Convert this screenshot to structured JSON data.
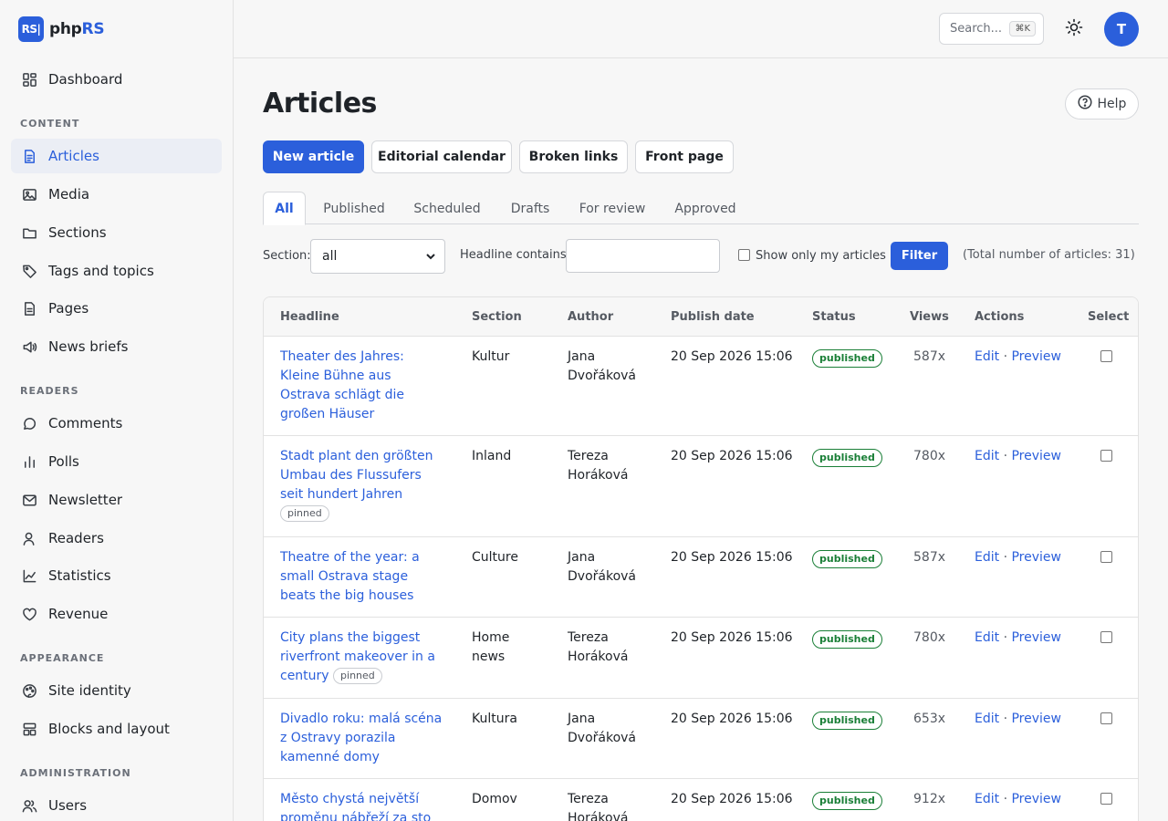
{
  "brand": {
    "logo_text": "RS|",
    "name_prefix": "php",
    "name_suffix": "RS",
    "accent": "#2b5fdb"
  },
  "sidebar": {
    "items": [
      {
        "label": "Dashboard",
        "icon": "dashboard-icon"
      },
      {
        "label": "Articles",
        "icon": "document-icon",
        "active": true
      },
      {
        "label": "Media",
        "icon": "image-icon"
      },
      {
        "label": "Sections",
        "icon": "folder-icon"
      },
      {
        "label": "Tags and topics",
        "icon": "tag-icon"
      },
      {
        "label": "Pages",
        "icon": "page-icon"
      },
      {
        "label": "News briefs",
        "icon": "megaphone-icon"
      },
      {
        "label": "Comments",
        "icon": "comment-icon"
      },
      {
        "label": "Polls",
        "icon": "poll-icon"
      },
      {
        "label": "Newsletter",
        "icon": "mail-icon"
      },
      {
        "label": "Readers",
        "icon": "user-icon"
      },
      {
        "label": "Statistics",
        "icon": "chart-icon"
      },
      {
        "label": "Revenue",
        "icon": "heart-icon"
      },
      {
        "label": "Site identity",
        "icon": "palette-icon"
      },
      {
        "label": "Blocks and layout",
        "icon": "layout-icon"
      },
      {
        "label": "Users",
        "icon": "users-icon"
      }
    ],
    "sections": {
      "content": "CONTENT",
      "readers": "READERS",
      "appearance": "APPEARANCE",
      "administration": "ADMINISTRATION"
    }
  },
  "topbar": {
    "search_label": "Search...",
    "search_shortcut": "⌘K",
    "theme_icon": "sun-icon",
    "avatar_initial": "T"
  },
  "main": {
    "title": "Articles",
    "help_label": "Help",
    "actions": {
      "new_article": "New article",
      "editorial_calendar": "Editorial calendar",
      "broken_links": "Broken links",
      "front_page": "Front page"
    },
    "tabs": [
      {
        "label": "All",
        "active": true
      },
      {
        "label": "Published"
      },
      {
        "label": "Scheduled"
      },
      {
        "label": "Drafts"
      },
      {
        "label": "For review"
      },
      {
        "label": "Approved"
      }
    ],
    "filters": {
      "section_label": "Section:",
      "section_value": "all",
      "headline_label": "Headline contains:",
      "headline_value": "",
      "only_mine_label": "Show only my articles",
      "only_mine_checked": false,
      "filter_button": "Filter",
      "total": "(Total number of articles: 31)"
    }
  },
  "table": {
    "columns": [
      "Headline",
      "Section",
      "Author",
      "Publish date",
      "Status",
      "Views",
      "Actions",
      "Select"
    ],
    "edit_label": "Edit",
    "separator": "·",
    "preview_label": "Preview",
    "rows": [
      {
        "headline": "Theater des Jahres: Kleine Bühne aus Ostrava schlägt die großen Häuser",
        "pinned": false,
        "section": "Kultur",
        "author": "Jana Dvořáková",
        "date": "20 Sep 2026 15:06",
        "status": "published",
        "views": "587x"
      },
      {
        "headline": "Stadt plant den größten Umbau des Flussufers seit hundert Jahren",
        "pinned": true,
        "pinned_label": "pinned",
        "section": "Inland",
        "author": "Tereza Horáková",
        "date": "20 Sep 2026 15:06",
        "status": "published",
        "views": "780x"
      },
      {
        "headline": "Theatre of the year: a small Ostrava stage beats the big houses",
        "pinned": false,
        "section": "Culture",
        "author": "Jana Dvořáková",
        "date": "20 Sep 2026 15:06",
        "status": "published",
        "views": "587x"
      },
      {
        "headline": "City plans the biggest riverfront makeover in a century",
        "pinned": true,
        "pinned_label": "pinned",
        "section": "Home news",
        "author": "Tereza Horáková",
        "date": "20 Sep 2026 15:06",
        "status": "published",
        "views": "780x"
      },
      {
        "headline": "Divadlo roku: malá scéna z Ostravy porazila kamenné domy",
        "pinned": false,
        "section": "Kultura",
        "author": "Jana Dvořáková",
        "date": "20 Sep 2026 15:06",
        "status": "published",
        "views": "653x"
      },
      {
        "headline": "Město chystá největší proměnu nábřeží za sto let",
        "pinned": false,
        "section": "Domov",
        "author": "Tereza Horáková",
        "date": "20 Sep 2026 15:06",
        "status": "published",
        "views": "912x"
      }
    ]
  },
  "colors": {
    "accent": "#2b5fdb",
    "status_published": "#1a7f37"
  }
}
